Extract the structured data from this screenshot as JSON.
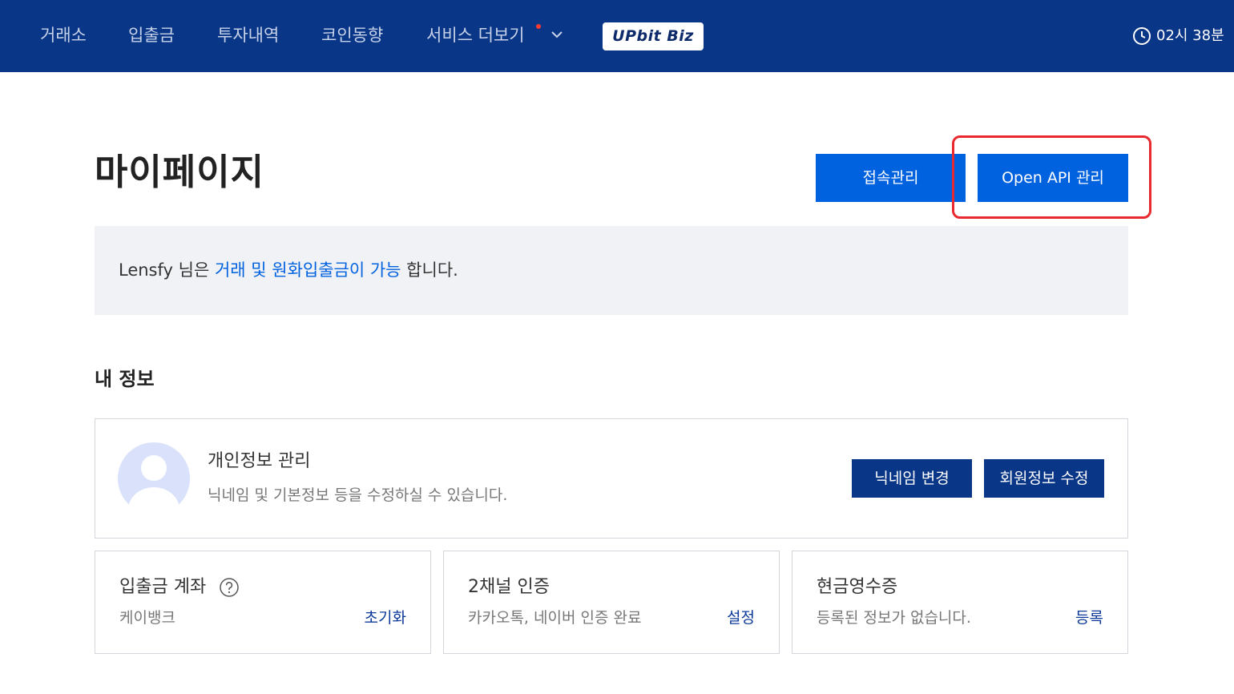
{
  "nav": {
    "items": [
      "거래소",
      "입출금",
      "투자내역",
      "코인동향",
      "서비스 더보기"
    ],
    "biz_logo": "UPbit Biz",
    "time": "02시 38분"
  },
  "page": {
    "title": "마이페이지",
    "access_button": "접속관리",
    "api_button": "Open API 관리"
  },
  "notice": {
    "prefix": "Lensfy 님은 ",
    "accent": "거래 및 원화입출금이 가능",
    "suffix": " 합니다."
  },
  "my_info": {
    "section_title": "내 정보",
    "profile": {
      "title": "개인정보 관리",
      "description": "닉네임 및 기본정보 등을 수정하실 수 있습니다.",
      "nickname_button": "닉네임 변경",
      "member_button": "회원정보 수정"
    },
    "cards": [
      {
        "title": "입출금 계좌",
        "subtitle": "케이뱅크",
        "link": "초기화"
      },
      {
        "title": "2채널 인증",
        "subtitle": "카카오톡, 네이버 인증 완료",
        "link": "설정"
      },
      {
        "title": "현금영수증",
        "subtitle": "등록된 정보가 없습니다.",
        "link": "등록"
      }
    ]
  },
  "colors": {
    "nav_bg": "#093687",
    "primary": "#0062df",
    "dark_button": "#093687",
    "highlight": "#e8292f",
    "notice_bg": "#f1f2f6"
  },
  "icons": [
    "clock-icon",
    "chevron-down-icon",
    "help-icon",
    "avatar-icon"
  ]
}
